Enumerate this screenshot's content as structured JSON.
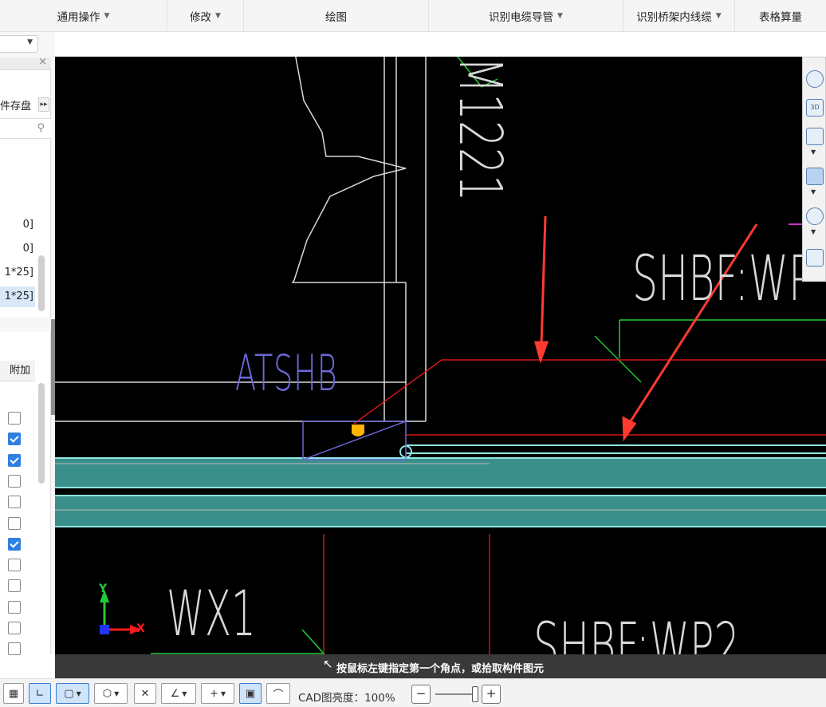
{
  "ribbon": {
    "items": [
      {
        "label": "通用操作",
        "dropdown": true
      },
      {
        "label": "修改",
        "dropdown": true
      },
      {
        "label": "绘图",
        "dropdown": false
      },
      {
        "label": "识别电缆导管",
        "dropdown": true
      },
      {
        "label": "识别桥架内线缆",
        "dropdown": true
      },
      {
        "label": "表格算量",
        "dropdown": false
      }
    ]
  },
  "sidebar": {
    "tab_text": "件存盘",
    "expand_glyph": "▸▸",
    "list_items": [
      {
        "label": "0]",
        "selected": false
      },
      {
        "label": "0]",
        "selected": false
      },
      {
        "label": "1*25]",
        "selected": false
      },
      {
        "label": "1*25]",
        "selected": true
      }
    ],
    "column_header": "附加",
    "checkboxes": [
      false,
      true,
      true,
      false,
      false,
      false,
      true,
      false,
      false,
      false,
      false,
      false
    ]
  },
  "canvas": {
    "labels": {
      "atshb": "ATSHB",
      "m1221": "M1221",
      "shbf_wp": "SHBF:WP",
      "shbf_wp2": "SHBF:WP2",
      "wx1": "WX1",
      "axis_x": "X",
      "axis_y": "Y"
    },
    "colors": {
      "background": "#000000",
      "duct": "#3a8f8a",
      "duct_edge": "#8fe8e0",
      "red_line": "#ff1a1a",
      "green_line": "#22cc33",
      "violet_text": "#6a68d8",
      "white_line": "#d8d8d8",
      "marker": "#ffb400",
      "arrow": "#ff3b30"
    }
  },
  "hint": {
    "text": "按鼠标左键指定第一个角点，或拾取构件图元"
  },
  "status": {
    "brightness_label": "CAD图亮度：",
    "brightness_value": "100%"
  }
}
